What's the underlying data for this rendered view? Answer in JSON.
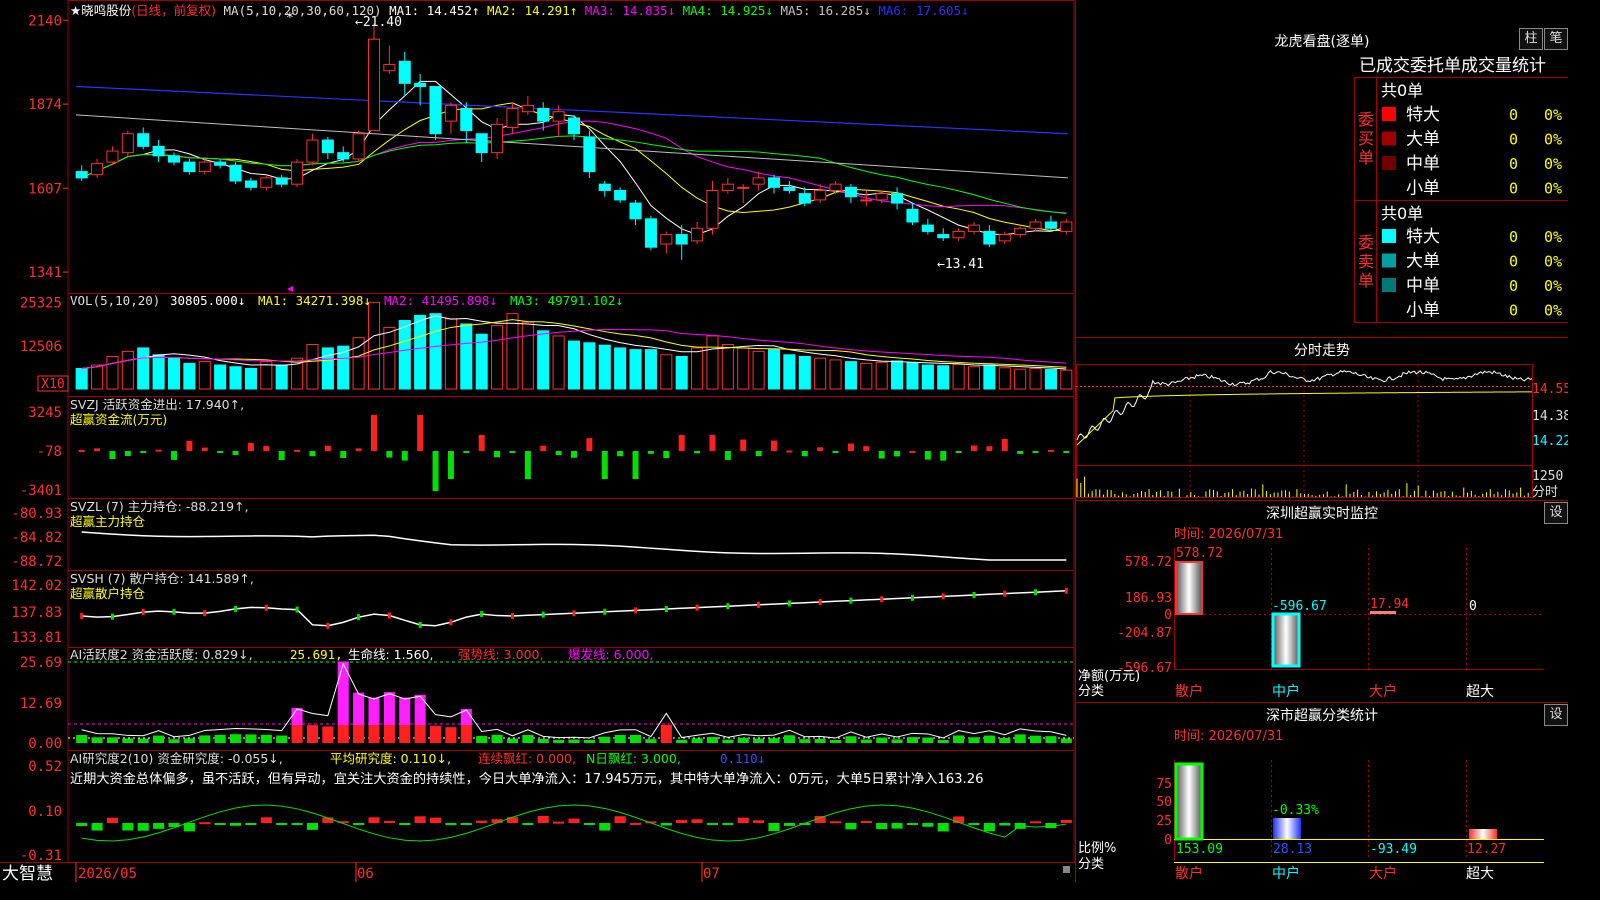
{
  "header": {
    "stock_title": "★晓鸣股份",
    "period": "(日线，前复权)",
    "ma_label": "MA(5,10,20,30,60,120)",
    "ma1": "MA1: 14.452↑",
    "ma2": "MA2: 14.291↑",
    "ma3": "MA3: 14.835↓",
    "ma4": "MA4: 14.925↓",
    "ma5": "MA5: 16.285↓",
    "ma6": "MA6: 17.605↓",
    "high_mark": "←21.40",
    "low_mark": "←13.41",
    "star": "*"
  },
  "price_axis": [
    "2140",
    "1874",
    "1607",
    "1341"
  ],
  "vol": {
    "label": "VOL(5,10,20)",
    "value": "30805.000↓",
    "ma1": "MA1: 34271.398↓",
    "ma2": "MA2: 41495.898↓",
    "ma3": "MA3: 49791.102↓",
    "axis": [
      "25325",
      "12506"
    ],
    "unit": "X10"
  },
  "svzj": {
    "label": "SVZJ  活跃资金进出: 17.940↑,",
    "sub": "超赢资金流(万元)",
    "axis": [
      "3245",
      "-78",
      "-3401"
    ]
  },
  "svzl": {
    "label": "SVZL (7) 主力持仓: -88.219↑,",
    "sub": "超赢主力持仓",
    "axis": [
      "-80.93",
      "-84.82",
      "-88.72"
    ]
  },
  "svsh": {
    "label": "SVSH (7) 散户持仓: 141.589↑,",
    "sub": "超赢散户持仓",
    "axis": [
      "142.02",
      "137.83",
      "133.81"
    ]
  },
  "ai1": {
    "prefix": "AI活跃度2 资金活跃度: 0.829↓,",
    "v2": "25.691,",
    "v3": "生命线: 1.560,",
    "v4": "强势线: 3.000,",
    "v5": "爆发线: 6.000,",
    "axis": [
      "25.69",
      "12.69",
      "0.00"
    ]
  },
  "ai2": {
    "prefix": "AI研究度2(10) 资金研究度: -0.055↓,",
    "v2": "平均研究度: 0.110↓,",
    "v3": "连续飘红: 0.000,",
    "v4": "N日飘红: 3.000,",
    "v5": "0.110↓",
    "desc": "近期大资金总体偏多，虽不活跃，但有异动，宜关注大资金的持续性，今日大单净流入：17.945万元，其中特大单净流入：0万元，大单5日累计净入163.26",
    "axis": [
      "0.52",
      "0.10",
      "-0.31"
    ]
  },
  "footer": {
    "brand": "大智慧",
    "d1": "2026/05",
    "d2": "06",
    "d3": "07"
  },
  "right": {
    "title": "龙虎看盘(逐单)",
    "btn1": "柱",
    "btn2": "笔",
    "tabs": "已成交委托单成交量统计",
    "buy_group": "委买单",
    "sell_group": "委卖单",
    "buy_total": "共0单",
    "sell_total": "共0单",
    "buy_rows": [
      {
        "name": "特大",
        "n": "0",
        "pct": "0%",
        "color": "#ff0000"
      },
      {
        "name": "大单",
        "n": "0",
        "pct": "0%",
        "color": "#a00000"
      },
      {
        "name": "中单",
        "n": "0",
        "pct": "0%",
        "color": "#700000"
      },
      {
        "name": "小单",
        "n": "0",
        "pct": "0%",
        "color": "#000000"
      }
    ],
    "sell_rows": [
      {
        "name": "特大",
        "n": "0",
        "pct": "0%",
        "color": "#00ffff"
      },
      {
        "name": "大单",
        "n": "0",
        "pct": "0%",
        "color": "#00a0a0"
      },
      {
        "name": "中单",
        "n": "0",
        "pct": "0%",
        "color": "#007878"
      },
      {
        "name": "小单",
        "n": "0",
        "pct": "0%",
        "color": "#000000"
      }
    ],
    "intraday_title": "分时走势",
    "intraday_axis": [
      "14.55",
      "14.38",
      "14.22"
    ],
    "intraday_vol": "1250",
    "intraday_unit": "分时",
    "monitor": {
      "title": "深圳超赢实时监控",
      "btn": "设",
      "time": "时间: 2026/07/31",
      "axis": [
        "578.72",
        "186.93",
        "0",
        "-204.87",
        "-596.67"
      ],
      "values": [
        "578.72",
        "-596.67",
        "17.94",
        "0"
      ],
      "ylabel": "净额(万元)",
      "xlabel": "分类",
      "cats": [
        "散户",
        "中户",
        "大户",
        "超大"
      ]
    },
    "classify": {
      "title": "深市超赢分类统计",
      "btn": "设",
      "time": "时间: 2026/07/31",
      "axis": [
        "75",
        "50",
        "25",
        "0"
      ],
      "mid": "-0.33%",
      "values": [
        "153.09",
        "28.13",
        "-93.49",
        "12.27"
      ],
      "ylabel": "比例%",
      "xlabel": "分类",
      "cats": [
        "散户",
        "中户",
        "大户",
        "超大"
      ]
    }
  },
  "chart_data": {
    "type": "candlestick",
    "price_scale": [
      1300,
      2160
    ],
    "candles": [
      [
        1660,
        1640,
        1680,
        1630
      ],
      [
        1650,
        1685,
        1700,
        1640
      ],
      [
        1690,
        1725,
        1740,
        1680
      ],
      [
        1720,
        1780,
        1790,
        1710
      ],
      [
        1780,
        1740,
        1800,
        1730
      ],
      [
        1740,
        1710,
        1760,
        1690
      ],
      [
        1710,
        1690,
        1720,
        1680
      ],
      [
        1690,
        1660,
        1700,
        1650
      ],
      [
        1660,
        1690,
        1700,
        1650
      ],
      [
        1690,
        1680,
        1700,
        1670
      ],
      [
        1680,
        1630,
        1690,
        1620
      ],
      [
        1630,
        1610,
        1640,
        1600
      ],
      [
        1610,
        1640,
        1650,
        1600
      ],
      [
        1640,
        1620,
        1650,
        1610
      ],
      [
        1620,
        1690,
        1700,
        1610
      ],
      [
        1690,
        1760,
        1780,
        1680
      ],
      [
        1760,
        1720,
        1770,
        1700
      ],
      [
        1720,
        1700,
        1740,
        1690
      ],
      [
        1700,
        1780,
        1790,
        1690
      ],
      [
        1790,
        2080,
        2130,
        1790
      ],
      [
        1980,
        2000,
        2060,
        1970
      ],
      [
        2010,
        1940,
        2040,
        1900
      ],
      [
        1940,
        1930,
        1970,
        1870
      ],
      [
        1930,
        1780,
        1930,
        1760
      ],
      [
        1820,
        1870,
        1880,
        1780
      ],
      [
        1860,
        1790,
        1880,
        1750
      ],
      [
        1780,
        1720,
        1780,
        1690
      ],
      [
        1720,
        1810,
        1830,
        1700
      ],
      [
        1800,
        1860,
        1880,
        1780
      ],
      [
        1850,
        1870,
        1900,
        1840
      ],
      [
        1860,
        1820,
        1880,
        1790
      ],
      [
        1820,
        1850,
        1870,
        1770
      ],
      [
        1830,
        1780,
        1840,
        1760
      ],
      [
        1770,
        1660,
        1790,
        1640
      ],
      [
        1620,
        1600,
        1630,
        1580
      ],
      [
        1600,
        1570,
        1610,
        1560
      ],
      [
        1560,
        1510,
        1570,
        1490
      ],
      [
        1510,
        1420,
        1520,
        1410
      ],
      [
        1430,
        1460,
        1470,
        1400
      ],
      [
        1460,
        1430,
        1490,
        1380
      ],
      [
        1440,
        1480,
        1500,
        1430
      ],
      [
        1480,
        1600,
        1630,
        1460
      ],
      [
        1600,
        1620,
        1640,
        1590
      ],
      [
        1610,
        1610,
        1620,
        1560
      ],
      [
        1620,
        1640,
        1660,
        1600
      ],
      [
        1640,
        1610,
        1650,
        1590
      ],
      [
        1610,
        1600,
        1630,
        1590
      ],
      [
        1590,
        1560,
        1610,
        1550
      ],
      [
        1570,
        1600,
        1620,
        1560
      ],
      [
        1600,
        1620,
        1630,
        1590
      ],
      [
        1610,
        1580,
        1620,
        1560
      ],
      [
        1570,
        1570,
        1600,
        1550
      ],
      [
        1570,
        1590,
        1600,
        1560
      ],
      [
        1590,
        1560,
        1610,
        1540
      ],
      [
        1540,
        1500,
        1560,
        1490
      ],
      [
        1490,
        1470,
        1510,
        1460
      ],
      [
        1460,
        1450,
        1480,
        1440
      ],
      [
        1450,
        1470,
        1480,
        1440
      ],
      [
        1470,
        1490,
        1500,
        1460
      ],
      [
        1470,
        1430,
        1490,
        1420
      ],
      [
        1440,
        1460,
        1470,
        1430
      ],
      [
        1460,
        1480,
        1490,
        1450
      ],
      [
        1480,
        1500,
        1510,
        1470
      ],
      [
        1500,
        1480,
        1520,
        1470
      ],
      [
        1470,
        1500,
        1510,
        1460
      ]
    ],
    "volume_scale": [
      0,
      26000
    ],
    "volume": [
      6000,
      7000,
      9500,
      11000,
      12000,
      10000,
      9000,
      7500,
      8000,
      7000,
      6500,
      6000,
      8000,
      7000,
      9000,
      13000,
      12000,
      12500,
      15000,
      25325,
      18000,
      20000,
      21500,
      22000,
      20500,
      19000,
      16000,
      18500,
      22000,
      19500,
      17000,
      15500,
      14000,
      13500,
      12800,
      12000,
      11500,
      11500,
      10000,
      9500,
      12000,
      15500,
      13000,
      12000,
      11000,
      11500,
      10000,
      9500,
      9000,
      8500,
      8000,
      7500,
      7800,
      8200,
      7600,
      7000,
      6800,
      7200,
      6500,
      7000,
      6200,
      5800,
      6000,
      5700,
      5500
    ]
  }
}
